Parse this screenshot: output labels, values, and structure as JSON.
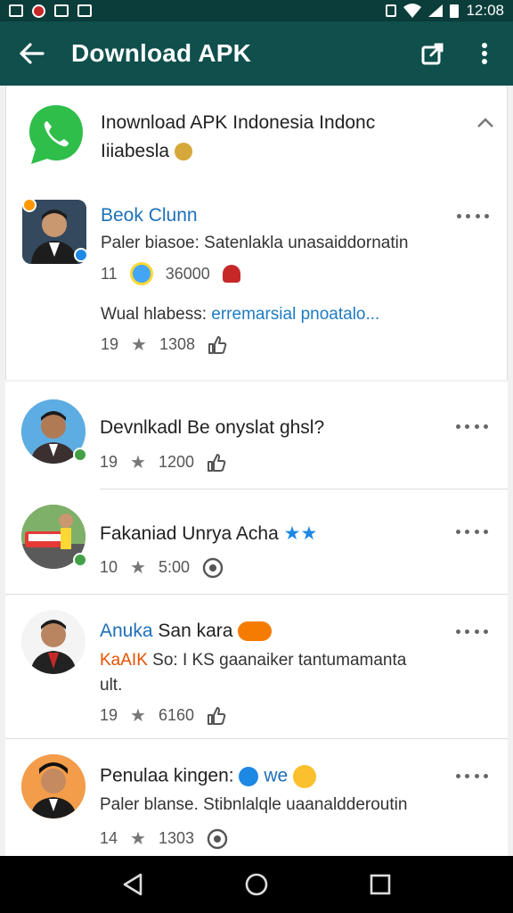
{
  "status_bar": {
    "time": "12:08"
  },
  "app_bar": {
    "title": "Download APK"
  },
  "group": {
    "title_line1": "Inownload APK Indonesia Indonc",
    "title_line2": "Iiiabesla"
  },
  "items": [
    {
      "name": "Beok Clunn",
      "subtitle": "Paler biasoe: Satenlakla unasaiddornatin",
      "meta_count": "11",
      "meta_value": "36000",
      "extra_prefix": "Wual hlabess:",
      "extra_link": "erremarsial pnoatalo...",
      "extra_meta_count": "19",
      "extra_meta_value": "1308"
    },
    {
      "name": "Devnlkadl Be onyslat ghsl?",
      "meta_count": "19",
      "meta_value": "1200"
    },
    {
      "name": "Fakaniad Unrya Acha",
      "meta_count": "10",
      "meta_value": "5:00"
    },
    {
      "name_blue": "Anuka",
      "name_rest": "San kara",
      "subtitle_orange": "KaAIK",
      "subtitle_line1": "So: I KS gaanaiker tantumamanta",
      "subtitle_line2": "ult.",
      "meta_count": "19",
      "meta_value": "6160"
    },
    {
      "name": "Penulaa kingen:",
      "name_tag": "we",
      "subtitle": "Paler blanse. Stibnlalqle uaanaldderoutin",
      "meta_count": "14",
      "meta_value": "1303"
    }
  ],
  "colors": {
    "app_bar": "#0f4f4c",
    "status_bar": "#0b3d3a",
    "link": "#1e7bc4",
    "accent_green": "#43a047"
  }
}
